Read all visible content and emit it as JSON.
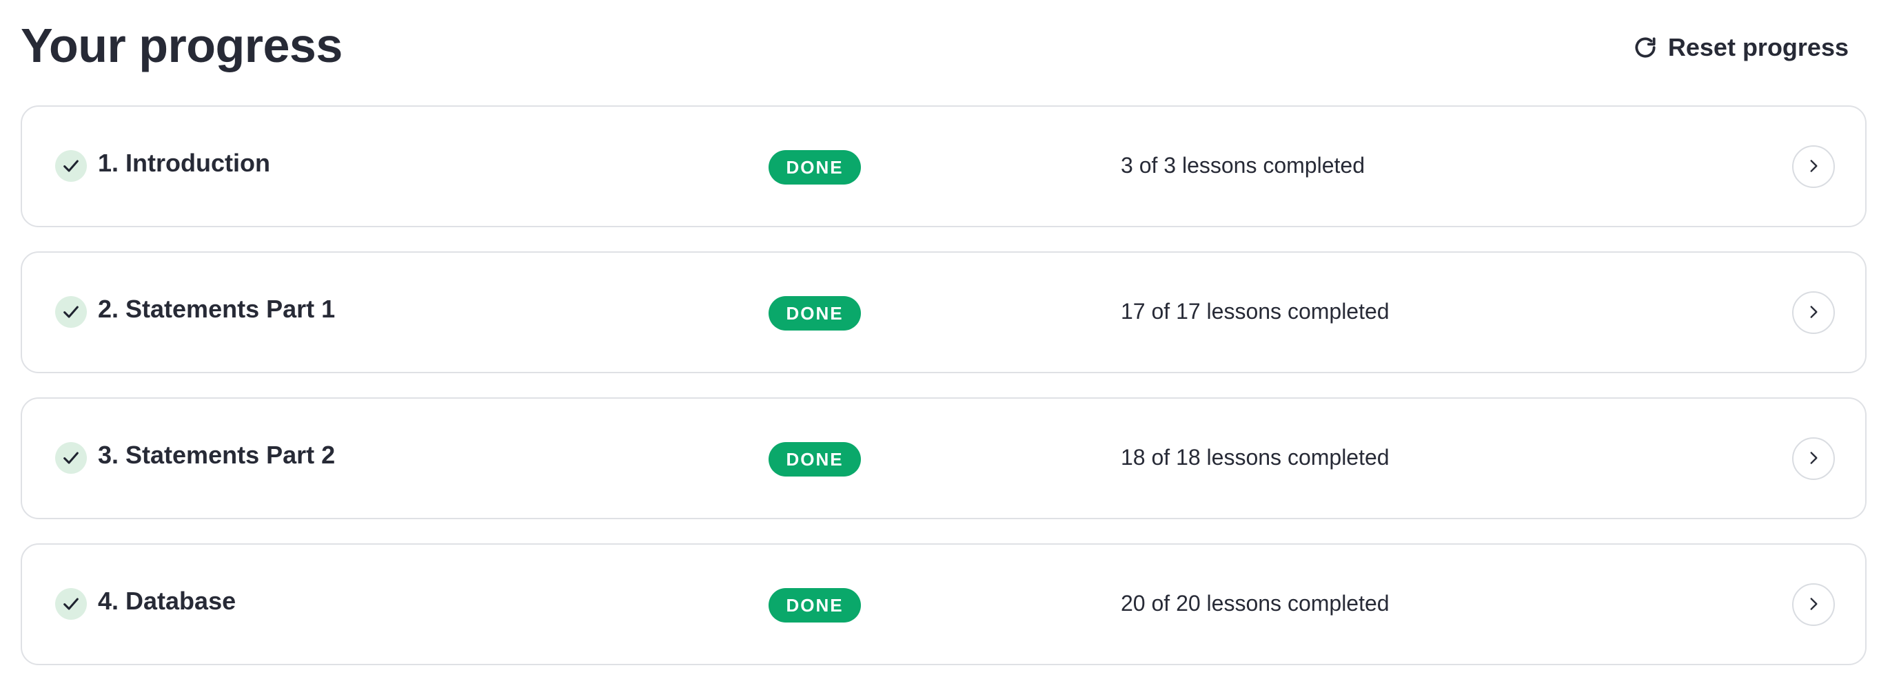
{
  "header": {
    "title": "Your progress",
    "reset_label": "Reset progress",
    "reset_icon": "reset-icon"
  },
  "colors": {
    "done_badge": "#0aa86a",
    "check_bg": "#dcefe2",
    "text": "#272a36",
    "border": "#dfe1e5"
  },
  "modules": [
    {
      "title": "1. Introduction",
      "status": "DONE",
      "lessons": "3 of 3 lessons completed",
      "completed": 3,
      "total": 3
    },
    {
      "title": "2. Statements Part 1",
      "status": "DONE",
      "lessons": "17 of 17 lessons completed",
      "completed": 17,
      "total": 17
    },
    {
      "title": "3. Statements Part 2",
      "status": "DONE",
      "lessons": "18 of 18 lessons completed",
      "completed": 18,
      "total": 18
    },
    {
      "title": "4. Database",
      "status": "DONE",
      "lessons": "20 of 20 lessons completed",
      "completed": 20,
      "total": 20
    }
  ],
  "icons": {
    "check": "check-icon",
    "chevron": "chevron-right-icon"
  }
}
